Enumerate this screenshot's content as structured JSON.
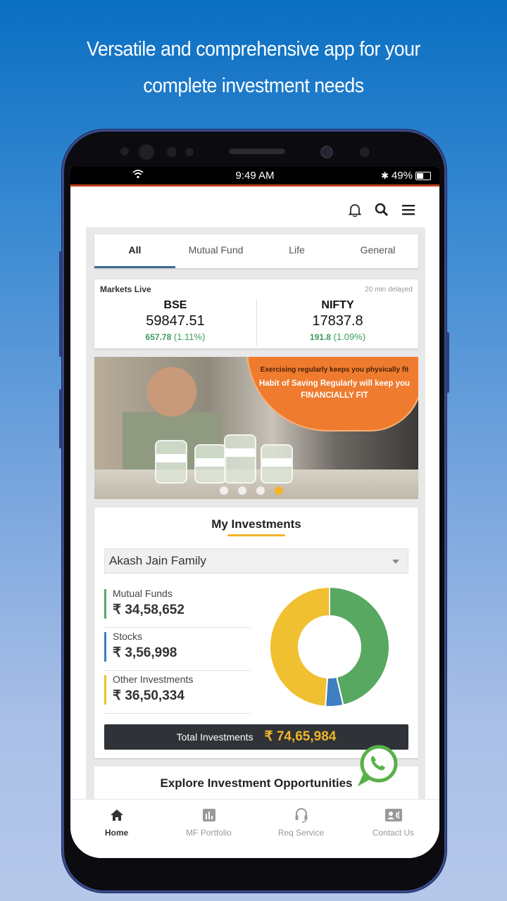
{
  "promo": {
    "headline_line1": "Versatile and comprehensive app for your",
    "headline_line2": "complete investment needs"
  },
  "status_bar": {
    "time": "9:49 AM",
    "battery": "49%",
    "icons": [
      "wifi-icon",
      "bluetooth-icon",
      "battery-icon"
    ]
  },
  "app_bar": {
    "icons": [
      "bell-icon",
      "search-icon",
      "menu-icon"
    ]
  },
  "tabs": [
    {
      "label": "All",
      "active": true
    },
    {
      "label": "Mutual Fund",
      "active": false
    },
    {
      "label": "Life",
      "active": false
    },
    {
      "label": "General",
      "active": false
    }
  ],
  "markets": {
    "title": "Markets Live",
    "delay_note": "20 min delayed",
    "indices": [
      {
        "name": "BSE",
        "value": "59847.51",
        "change": "657.78",
        "change_pct": "(1.11%)"
      },
      {
        "name": "NIFTY",
        "value": "17837.8",
        "change": "191.8",
        "change_pct": "(1.09%)"
      }
    ]
  },
  "banner": {
    "line1": "Exercising regularly keeps you physically fit",
    "line2": "Habit of Saving Regularly will keep you FINANCIALLY FIT",
    "slides": 4,
    "active_slide": 4
  },
  "investments": {
    "title": "My Investments",
    "family_select": "Akash Jain Family",
    "items": [
      {
        "label": "Mutual Funds",
        "amount": "₹ 34,58,652",
        "value": 3458652,
        "color": "#58a862"
      },
      {
        "label": "Stocks",
        "amount": "₹ 3,56,998",
        "value": 356998,
        "color": "#3d7fc0"
      },
      {
        "label": "Other Investments",
        "amount": "₹ 36,50,334",
        "value": 3650334,
        "color": "#f0c030"
      }
    ],
    "total_label": "Total Investments",
    "total_amount": "₹ 74,65,984"
  },
  "explore": {
    "title": "Explore Investment Opportunities"
  },
  "bottom_nav": [
    {
      "label": "Home",
      "icon": "home-icon",
      "active": true
    },
    {
      "label": "MF Portfolio",
      "icon": "bar-chart-icon",
      "active": false
    },
    {
      "label": "Req Service",
      "icon": "headset-icon",
      "active": false
    },
    {
      "label": "Contact Us",
      "icon": "contact-card-icon",
      "active": false
    }
  ],
  "chart_data": {
    "type": "pie",
    "title": "My Investments",
    "categories": [
      "Mutual Funds",
      "Stocks",
      "Other Investments"
    ],
    "values": [
      3458652,
      356998,
      3650334
    ],
    "colors": [
      "#58a862",
      "#3d7fc0",
      "#f0c030"
    ],
    "donut": true
  }
}
